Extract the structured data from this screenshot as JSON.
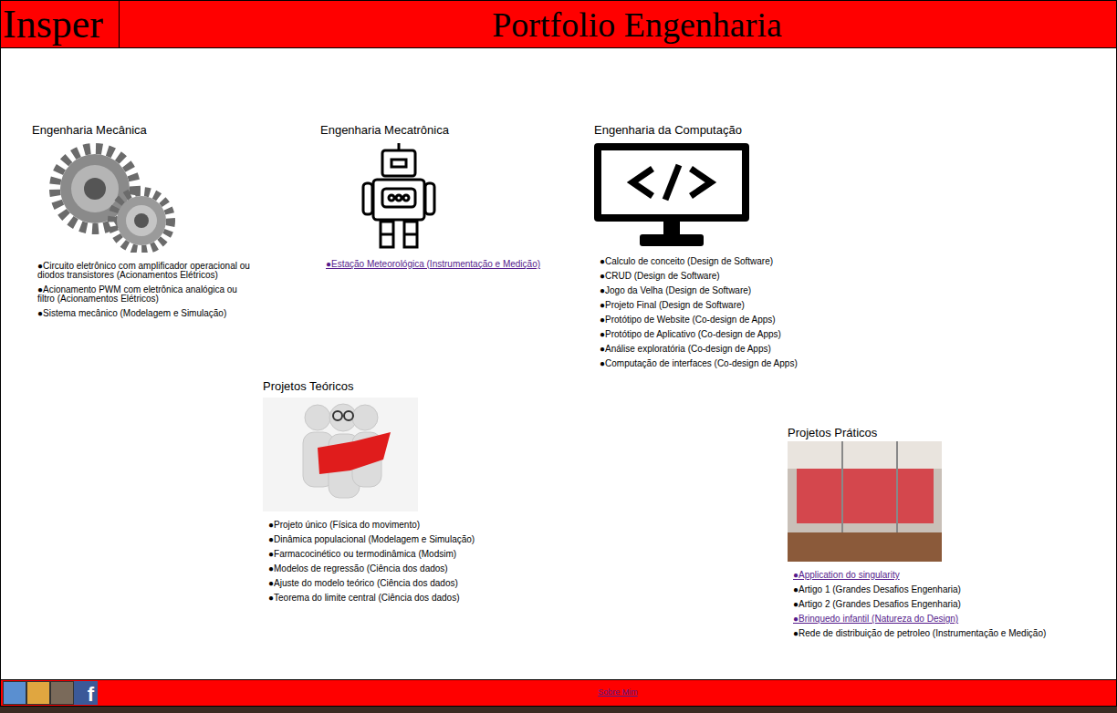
{
  "header": {
    "logo": "Insper",
    "title": "Portfolio Engenharia"
  },
  "rows": [
    [
      {
        "title": "Engenharia Mecânica",
        "kind": "gears",
        "items": [
          {
            "text": "●Circuito eletrônico com amplificador operacional ou diodos transistores (Acionamentos Elétricos)",
            "link": false
          },
          {
            "text": "●Acionamento PWM com eletrônica analógica ou filtro (Acionamentos Elétricos)",
            "link": false
          },
          {
            "text": "●Sistema mecânico (Modelagem e Simulação)",
            "link": false
          }
        ]
      },
      {
        "title": "Engenharia Mecatrônica",
        "kind": "robot",
        "items": [
          {
            "text": "●Estação Meteorológica (Instrumentação e Medição)",
            "link": true
          }
        ]
      },
      {
        "title": "Engenharia da Computação",
        "kind": "monitor",
        "items": [
          {
            "text": "●Calculo de conceito (Design de Software)",
            "link": false
          },
          {
            "text": "●CRUD (Design de Software)",
            "link": false
          },
          {
            "text": "●Jogo da Velha (Design de Software)",
            "link": false
          },
          {
            "text": "●Projeto Final (Design de Software)",
            "link": false
          },
          {
            "text": "●Protótipo de Website (Co-design de Apps)",
            "link": false
          },
          {
            "text": "●Protótipo de Aplicativo (Co-design de Apps)",
            "link": false
          },
          {
            "text": "●Análise exploratória (Co-design de Apps)",
            "link": false
          },
          {
            "text": "●Computação de interfaces (Co-design de Apps)",
            "link": false
          }
        ]
      }
    ],
    [
      {
        "title": "Projetos Teóricos",
        "kind": "readers",
        "items": [
          {
            "text": "●Projeto único (Física do movimento)",
            "link": false
          },
          {
            "text": "●Dinâmica populacional (Modelagem e Simulação)",
            "link": false
          },
          {
            "text": "●Farmacocinético ou termodinâmica (Modsim)",
            "link": false
          },
          {
            "text": "●Modelos de regressão (Ciência dos dados)",
            "link": false
          },
          {
            "text": "●Ajuste do modelo teórico (Ciência dos dados)",
            "link": false
          },
          {
            "text": "●Teorema do limite central (Ciência dos dados)",
            "link": false
          }
        ]
      },
      {
        "title": "Projetos Práticos",
        "kind": "fablab",
        "items": [
          {
            "text": "●Application do singularity",
            "link": true
          },
          {
            "text": "●Artigo 1 (Grandes Desafios Engenharia)",
            "link": false
          },
          {
            "text": "●Artigo 2 (Grandes Desafios Engenharia)",
            "link": false
          },
          {
            "text": "●Brinquedo infantil (Natureza do Design)",
            "link": true
          },
          {
            "text": "●Rede de distribuição de petroleo (Instrumentação e Medição)",
            "link": false
          }
        ]
      }
    ]
  ],
  "footer": {
    "facebook": "f",
    "link": "Sobre Mim"
  }
}
